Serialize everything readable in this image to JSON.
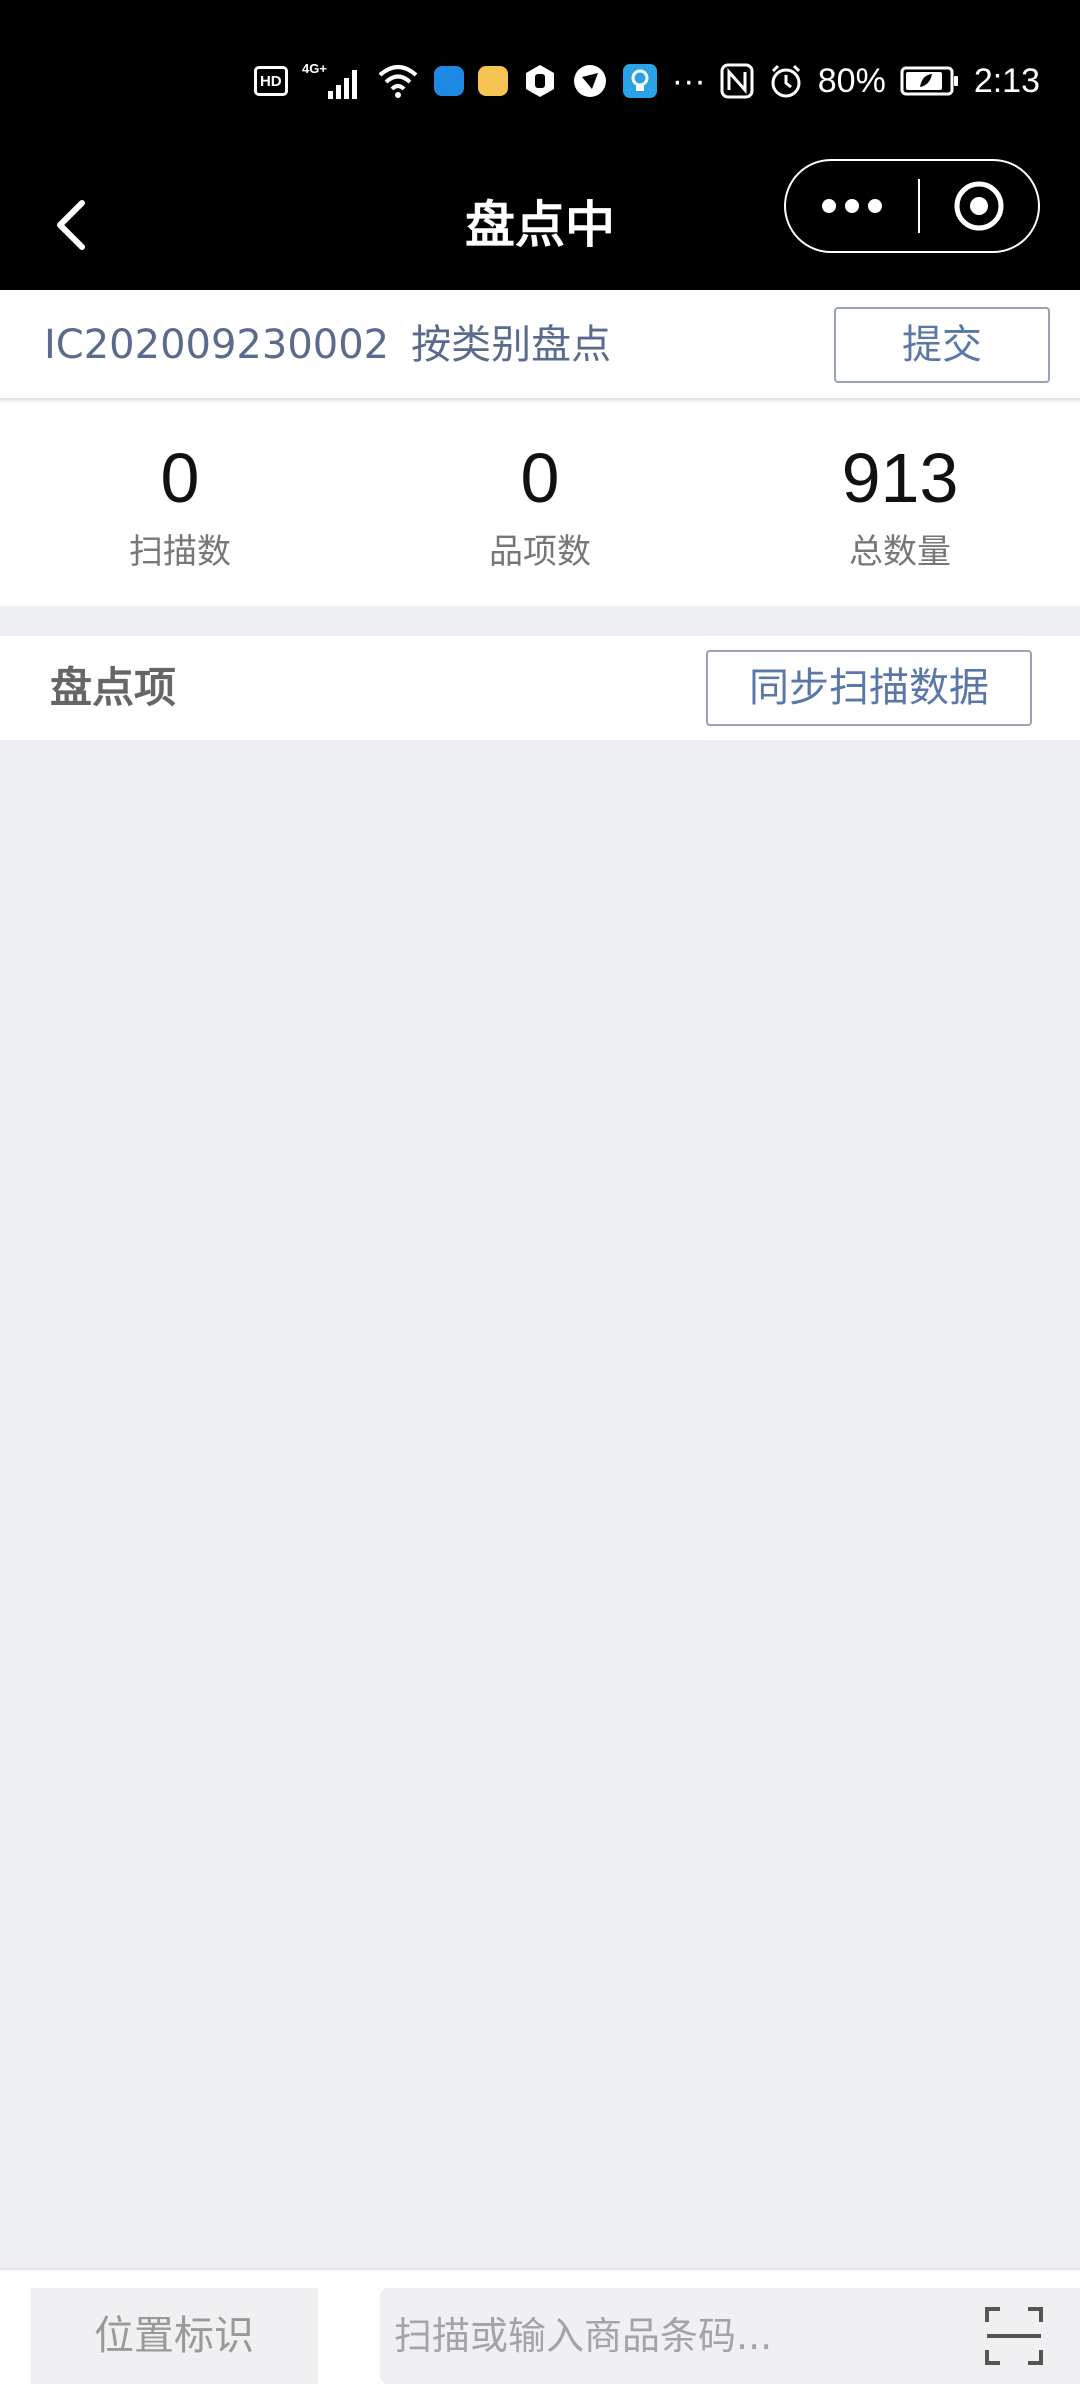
{
  "status_bar": {
    "network_badge": "HD",
    "network_type": "4G+",
    "more_indicator": "···",
    "battery_percent": "80%",
    "time": "2:13",
    "app_icon_colors": [
      "#1e88e5",
      "#f5c451",
      "#ffffff",
      "#ffffff",
      "#29a3e6"
    ]
  },
  "nav": {
    "title": "盘点中"
  },
  "header": {
    "doc_number": "IC202009230002",
    "mode": "按类别盘点",
    "submit_label": "提交"
  },
  "stats": [
    {
      "value": "0",
      "label": "扫描数"
    },
    {
      "value": "0",
      "label": "品项数"
    },
    {
      "value": "913",
      "label": "总数量"
    }
  ],
  "section": {
    "title": "盘点项",
    "sync_label": "同步扫描数据"
  },
  "items": [],
  "bottom_bar": {
    "location_label": "位置标识",
    "barcode_value": "",
    "barcode_placeholder": "扫描或输入商品条码..."
  },
  "colors": {
    "accent": "#5a77aa",
    "doc_text": "#5a6b8c",
    "background": "#eeeff3",
    "nav_background": "#000000"
  }
}
